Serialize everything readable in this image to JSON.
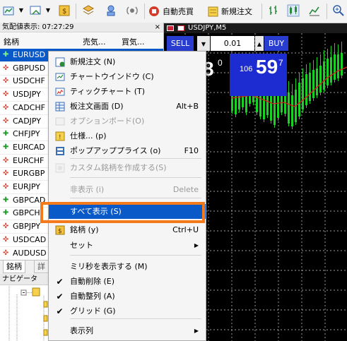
{
  "toolbar": {
    "auto_trade_label": "自動売買",
    "new_order_label": "新規注文"
  },
  "market_watch": {
    "title": "気配値表示: 07:27:29",
    "close_glyph": "×",
    "columns": [
      "銘柄",
      "売気...",
      "買気..."
    ],
    "rows": [
      {
        "symbol": "EURUSD",
        "direction": "up",
        "selected": true
      },
      {
        "symbol": "GBPUSD",
        "direction": "down"
      },
      {
        "symbol": "USDCHF",
        "direction": "down"
      },
      {
        "symbol": "USDJPY",
        "direction": "down"
      },
      {
        "symbol": "CADCHF",
        "direction": "down"
      },
      {
        "symbol": "CADJPY",
        "direction": "down"
      },
      {
        "symbol": "CHFJPY",
        "direction": "up"
      },
      {
        "symbol": "EURCAD",
        "direction": "up"
      },
      {
        "symbol": "EURCHF",
        "direction": "down"
      },
      {
        "symbol": "EURGBP",
        "direction": "down"
      },
      {
        "symbol": "EURJPY",
        "direction": "down"
      },
      {
        "symbol": "GBPCAD",
        "direction": "up"
      },
      {
        "symbol": "GBPCH",
        "direction": "up"
      },
      {
        "symbol": "GBPJPY",
        "direction": "down"
      },
      {
        "symbol": "USDCAD",
        "direction": "down"
      },
      {
        "symbol": "AUDUSD",
        "direction": "down"
      }
    ],
    "tabs": [
      "銘柄",
      "詳"
    ]
  },
  "navigator": {
    "title": "ナビゲータ"
  },
  "chart": {
    "title": "USDJPY,M5",
    "sell_label": "SELL",
    "buy_label": "BUY",
    "lot": "0.01",
    "bid_big": "8",
    "bid_sup": "0",
    "ask_prefix": "106",
    "ask_big": "59",
    "ask_sup": "7"
  },
  "context_menu": {
    "items": [
      {
        "label": "新規注文 (N)",
        "icon": "new-order-icon",
        "shortcut": ""
      },
      {
        "label": "チャートウインドウ (C)",
        "icon": "chart-window-icon",
        "shortcut": ""
      },
      {
        "label": "ティックチャート (T)",
        "icon": "tick-chart-icon",
        "shortcut": ""
      },
      {
        "label": "板注文画面 (D)",
        "icon": "depth-of-market-icon",
        "shortcut": "Alt+B"
      },
      {
        "label": "オプションボード(O)",
        "icon": "option-board-icon",
        "shortcut": "",
        "disabled": true
      },
      {
        "label": "仕様... (p)",
        "icon": "specification-icon",
        "shortcut": ""
      },
      {
        "label": "ポップアッププライス (o)",
        "icon": "popup-prices-icon",
        "shortcut": "F10"
      },
      {
        "label": "カスタム銘柄を作成する(S)",
        "icon": "custom-symbol-icon",
        "shortcut": "",
        "disabled": true
      },
      {
        "label": "非表示 (i)",
        "icon": "",
        "shortcut": "Delete",
        "disabled": true
      },
      {
        "label": "すべて表示 (S)",
        "icon": "",
        "shortcut": "",
        "highlighted": true
      },
      {
        "label": "銘柄 (y)",
        "icon": "symbols-icon",
        "shortcut": "Ctrl+U"
      },
      {
        "label": "セット",
        "icon": "",
        "shortcut": "",
        "submenu": true
      },
      {
        "label": "ミリ秒を表示する (M)",
        "icon": "",
        "shortcut": ""
      },
      {
        "label": "自動削除 (E)",
        "icon": "check-icon",
        "shortcut": ""
      },
      {
        "label": "自動整列 (A)",
        "icon": "check-icon",
        "shortcut": ""
      },
      {
        "label": "グリッド (G)",
        "icon": "check-icon",
        "shortcut": ""
      },
      {
        "label": "表示列",
        "icon": "",
        "shortcut": "",
        "submenu": true
      }
    ]
  },
  "colors": {
    "selection": "#0a59c8",
    "highlight_frame": "#f47a1b",
    "chart_bg": "#000000",
    "candle_up": "#18d224",
    "ma_line": "#d42424",
    "price_box": "#1d2cd1"
  }
}
